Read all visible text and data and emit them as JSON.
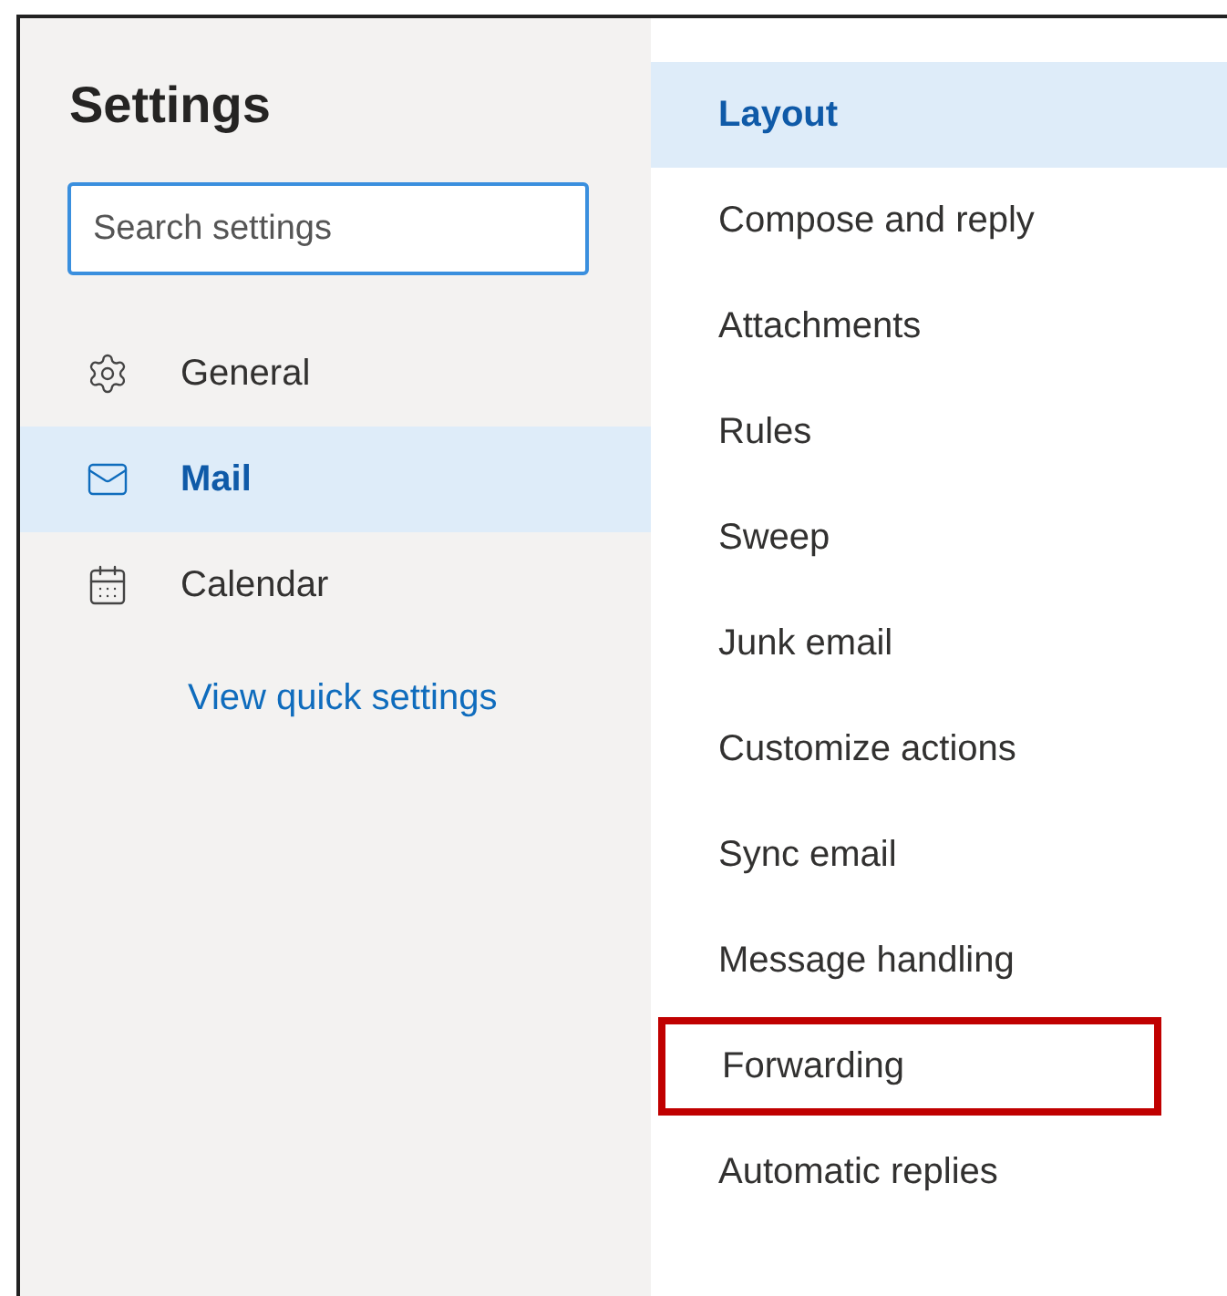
{
  "title": "Settings",
  "search": {
    "placeholder": "Search settings"
  },
  "nav": [
    {
      "label": "General",
      "selected": false
    },
    {
      "label": "Mail",
      "selected": true
    },
    {
      "label": "Calendar",
      "selected": false
    }
  ],
  "quick_link": "View quick settings",
  "sections": [
    {
      "label": "Layout",
      "selected": true,
      "highlighted": false
    },
    {
      "label": "Compose and reply",
      "selected": false,
      "highlighted": false
    },
    {
      "label": "Attachments",
      "selected": false,
      "highlighted": false
    },
    {
      "label": "Rules",
      "selected": false,
      "highlighted": false
    },
    {
      "label": "Sweep",
      "selected": false,
      "highlighted": false
    },
    {
      "label": "Junk email",
      "selected": false,
      "highlighted": false
    },
    {
      "label": "Customize actions",
      "selected": false,
      "highlighted": false
    },
    {
      "label": "Sync email",
      "selected": false,
      "highlighted": false
    },
    {
      "label": "Message handling",
      "selected": false,
      "highlighted": false
    },
    {
      "label": "Forwarding",
      "selected": false,
      "highlighted": true
    },
    {
      "label": "Automatic replies",
      "selected": false,
      "highlighted": false
    }
  ]
}
